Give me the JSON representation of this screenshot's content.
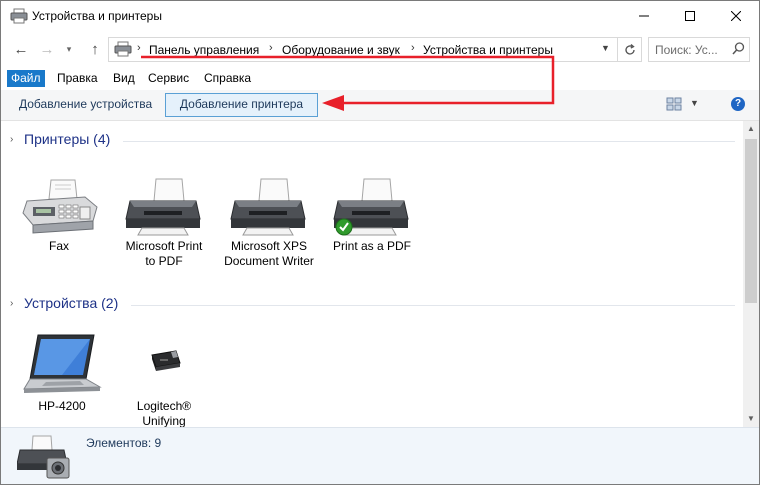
{
  "window": {
    "title": "Устройства и принтеры",
    "controls": {
      "minimize": "minimize-icon",
      "maximize": "maximize-icon",
      "close": "close-icon"
    }
  },
  "address": {
    "crumbs": [
      "Панель управления",
      "Оборудование и звук",
      "Устройства и принтеры"
    ],
    "search_placeholder": "Поиск: Ус..."
  },
  "menu": [
    "Файл",
    "Правка",
    "Вид",
    "Сервис",
    "Справка"
  ],
  "commands": {
    "add_device": "Добавление устройства",
    "add_printer": "Добавление принтера"
  },
  "groups": {
    "printers": {
      "title": "Принтеры (4)",
      "items": [
        {
          "label": "Fax",
          "icon": "fax-icon"
        },
        {
          "label": "Microsoft Print to PDF",
          "icon": "printer-icon"
        },
        {
          "label": "Microsoft XPS Document Writer",
          "icon": "printer-icon"
        },
        {
          "label": "Print as a PDF",
          "icon": "printer-default-icon"
        }
      ]
    },
    "devices": {
      "title": "Устройства (2)",
      "items": [
        {
          "label": "HP-4200",
          "icon": "laptop-icon"
        },
        {
          "label": "Logitech® Unifying",
          "icon": "usb-receiver-icon"
        }
      ]
    }
  },
  "status": {
    "text": "Элементов: 9"
  },
  "colors": {
    "accent": "#1979ca",
    "group_title": "#1e3287",
    "annotation": "#e8202a"
  }
}
